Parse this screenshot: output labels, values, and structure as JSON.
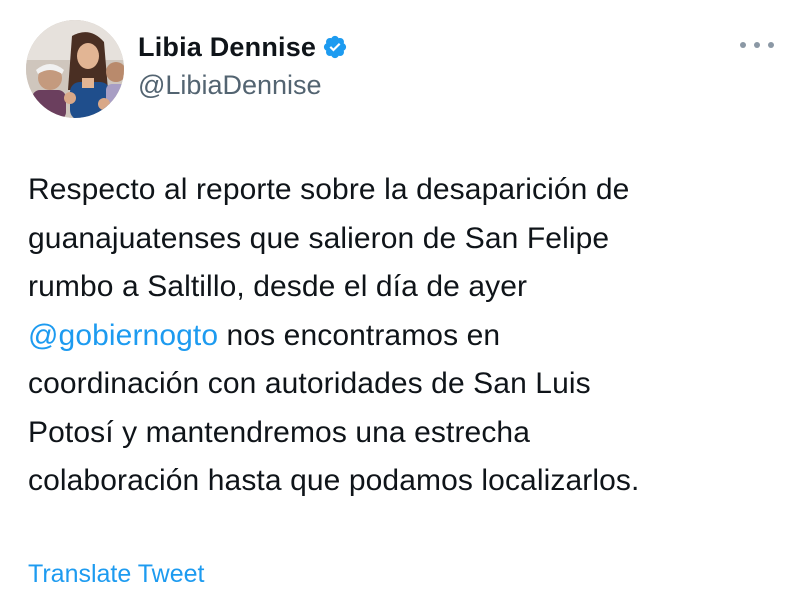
{
  "author": {
    "display_name": "Libia Dennise",
    "handle": "@LibiaDennise",
    "verified_icon": "verified-badge-icon",
    "verified_color": "#1d9bf0"
  },
  "menu": {
    "icon": "more-options-icon"
  },
  "tweet": {
    "line_1": "Respecto al reporte sobre la desaparición de",
    "line_2": "guanajuatenses que salieron de San Felipe",
    "line_3": "rumbo a Saltillo, desde el día de ayer",
    "mention": "@gobiernogto",
    "line_4_rest": " nos encontramos en",
    "line_5": "coordinación con autoridades de San Luis",
    "line_6": "Potosí y mantendremos una estrecha",
    "line_7": "colaboración hasta que podamos localizarlos."
  },
  "actions": {
    "translate_label": "Translate Tweet"
  },
  "colors": {
    "text": "#0f1419",
    "secondary": "#536471",
    "link": "#1d9bf0"
  }
}
